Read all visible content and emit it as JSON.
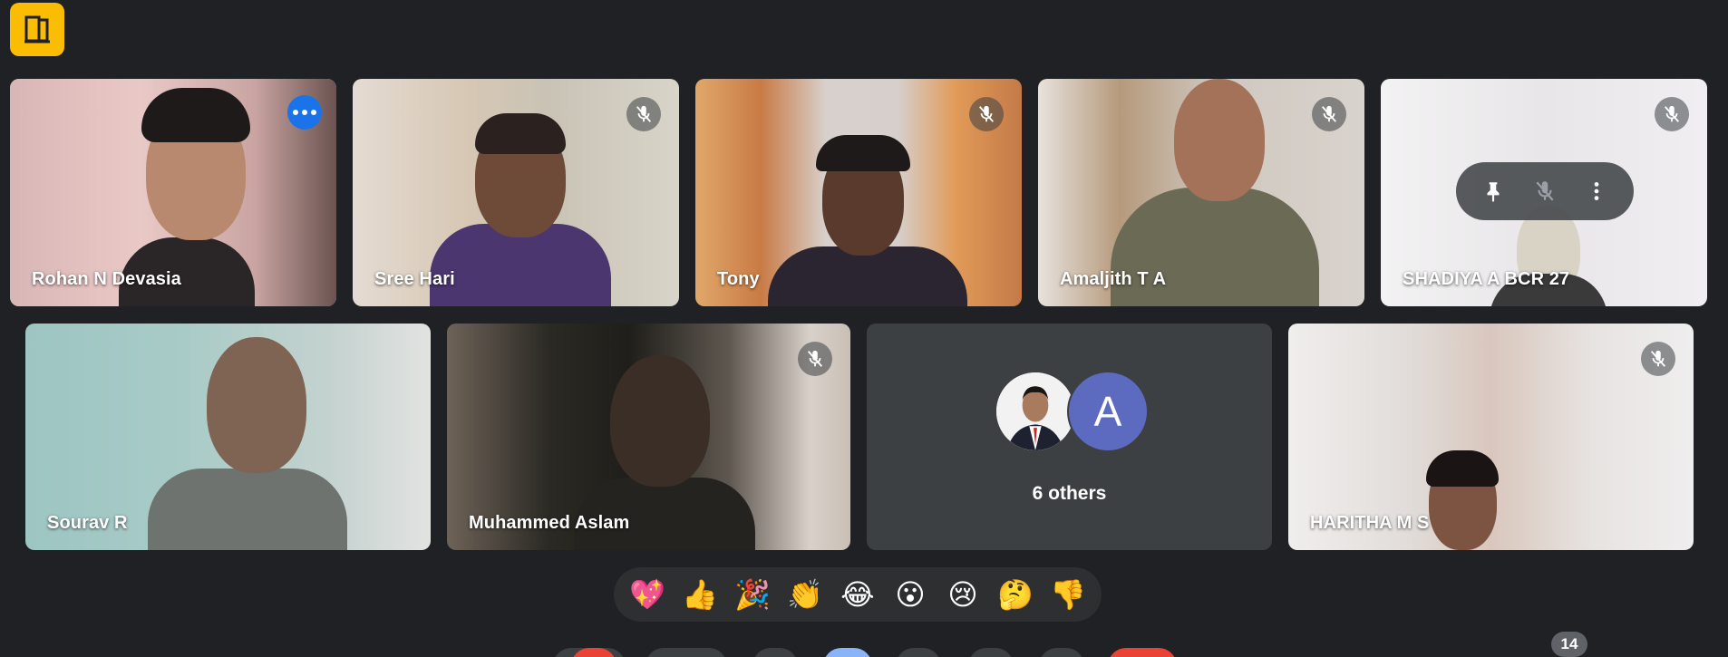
{
  "app": {
    "icon": "door-exit-icon",
    "accent": "#fbbc04"
  },
  "participants": [
    {
      "name": "Rohan N Devasia",
      "active": true,
      "control": "more-options"
    },
    {
      "name": "Sree Hari",
      "muted": true
    },
    {
      "name": "Tony",
      "muted": true
    },
    {
      "name": "Amaljith T A",
      "muted": true
    },
    {
      "name": "SHADIYA A BCR 27",
      "muted": true,
      "hover_controls": [
        "pin-icon",
        "mic-off-icon",
        "more-vert-icon"
      ]
    },
    {
      "name": "Sourav R"
    },
    {
      "name": "Muhammed Aslam",
      "muted": true
    },
    {
      "name": "HARITHA M S",
      "muted": true
    }
  ],
  "others": {
    "label": "6 others",
    "avatar_letter": "A",
    "avatar_color": "#5c6bc0"
  },
  "reactions": [
    "💖",
    "👍",
    "🎉",
    "👏",
    "😂",
    "😮",
    "😢",
    "🤔",
    "👎"
  ],
  "people_count": "14",
  "colors": {
    "active_border": "#8ab4f8",
    "more_button": "#1a73e8",
    "background": "#202124"
  }
}
